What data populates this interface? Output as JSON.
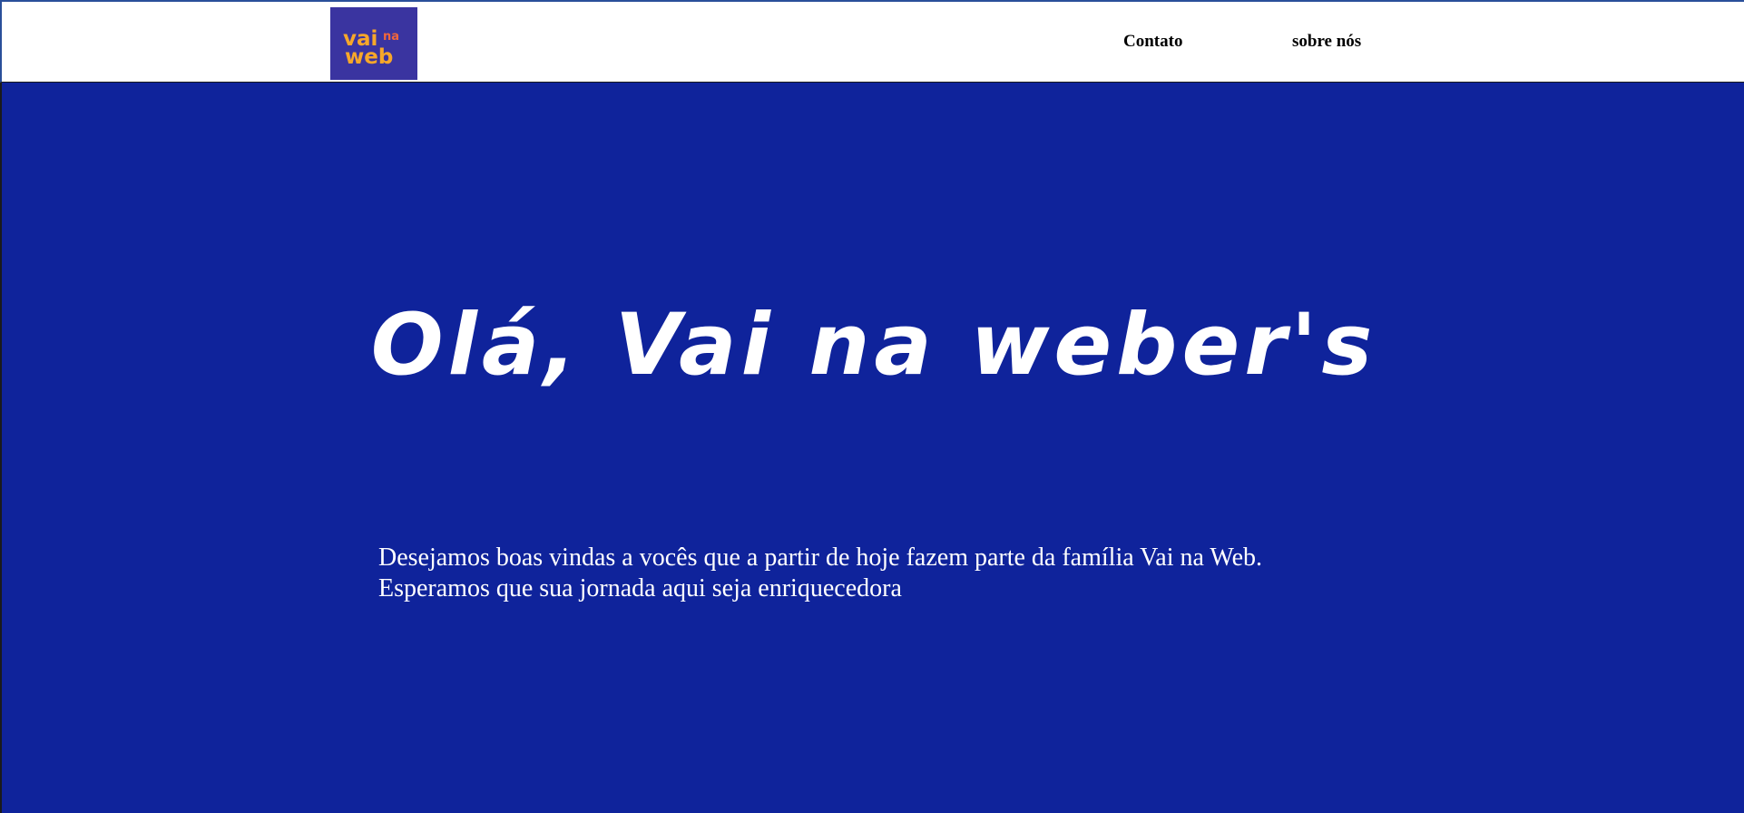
{
  "header": {
    "logo": {
      "line1": "vai",
      "line1_small": "na",
      "line2": "web",
      "background": "#3a34a0",
      "text_color": "#f7a72a",
      "accent_color": "#f2663a"
    },
    "nav": {
      "contato_label": "Contato",
      "sobre_label": "sobre nós"
    }
  },
  "hero": {
    "background": "#0f239b",
    "title": "Olá, Vai na weber's",
    "paragraph_line1": "Desejamos boas vindas a vocês que a partir de hoje fazem parte da família Vai na Web.",
    "paragraph_line2": "Esperamos que sua jornada aqui seja enriquecedora"
  }
}
